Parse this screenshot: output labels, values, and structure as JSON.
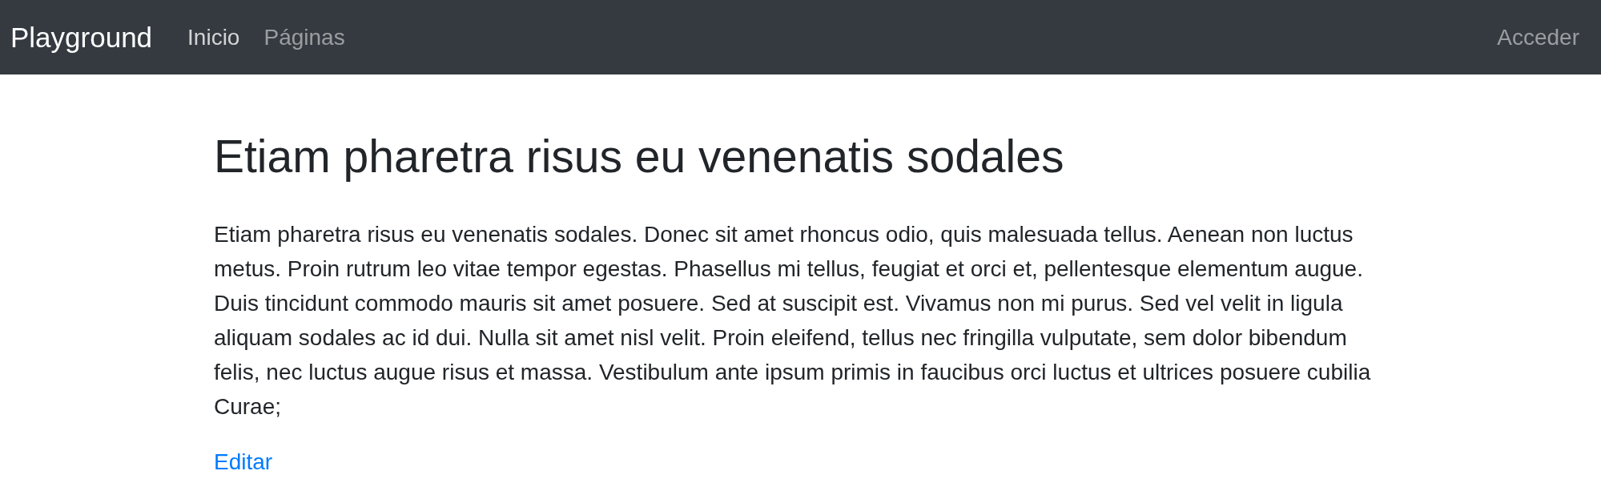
{
  "navbar": {
    "brand": "Playground",
    "links": [
      {
        "label": "Inicio",
        "selected": true
      },
      {
        "label": "Páginas",
        "selected": false
      }
    ],
    "login": "Acceder"
  },
  "main": {
    "title": "Etiam pharetra risus eu venenatis sodales",
    "body": "Etiam pharetra risus eu venenatis sodales. Donec sit amet rhoncus odio, quis malesuada tellus. Aenean non luctus metus. Proin rutrum leo vitae tempor egestas. Phasellus mi tellus, feugiat et orci et, pellentesque elementum augue. Duis tincidunt commodo mauris sit amet posuere. Sed at suscipit est. Vivamus non mi purus. Sed vel velit in ligula aliquam sodales ac id dui. Nulla sit amet nisl velit. Proin eleifend, tellus nec fringilla vulputate, sem dolor bibendum felis, nec luctus augue risus et massa. Vestibulum ante ipsum primis in faucibus orci luctus et ultrices posuere cubilia Curae;",
    "edit_link": "Editar"
  }
}
